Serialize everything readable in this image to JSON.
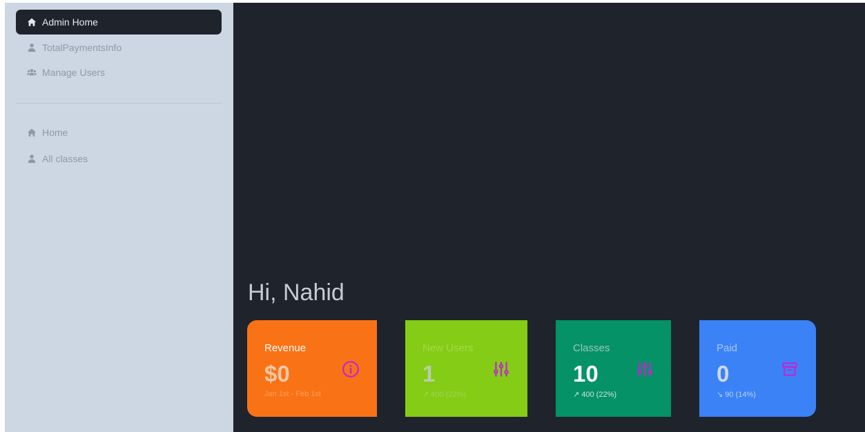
{
  "sidebar": {
    "items": [
      {
        "label": "Admin Home",
        "icon": "home-icon",
        "active": true
      },
      {
        "label": "TotalPaymentsInfo",
        "icon": "user-icon"
      },
      {
        "label": "Manage Users",
        "icon": "users-icon"
      },
      {
        "label": "Home",
        "icon": "home-icon"
      },
      {
        "label": "All classes",
        "icon": "user-icon"
      }
    ]
  },
  "main": {
    "greeting": "Hi, Nahid",
    "stats": [
      {
        "label": "Revenue",
        "value": "$0",
        "sub": "Jan 1st - Feb 1st",
        "icon": "info-icon",
        "color": "#f97316"
      },
      {
        "label": "New Users",
        "value": "1",
        "sub": "↗ 400 (22%)",
        "icon": "sliders-icon",
        "color": "#84cc16"
      },
      {
        "label": "Classes",
        "value": "10",
        "sub": "↗ 400 (22%)",
        "icon": "sliders-icon",
        "color": "#059266"
      },
      {
        "label": "Paid",
        "value": "0",
        "sub": "↘ 90 (14%)",
        "icon": "archive-icon",
        "color": "#3b82f6"
      }
    ]
  },
  "colors": {
    "sidebar_bg": "#cdd7e3",
    "main_bg": "#1f232b",
    "icon_accent": "#c026d3"
  }
}
